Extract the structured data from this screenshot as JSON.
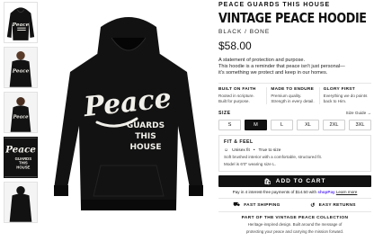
{
  "product": {
    "brand": "PEACE GUARDS THIS HOUSE",
    "title": "VINTAGE PEACE HOODIE",
    "variant": "BLACK / BONE",
    "price": "$58.00",
    "description": [
      "A statement of protection and purpose.",
      "This hoodie is a reminder that peace isn't just personal—",
      "it's something we protect and keep in our homes."
    ]
  },
  "graphic": {
    "script": "Peace",
    "line1": "GUARDS",
    "line2": "THIS",
    "line3": "HOUSE"
  },
  "features": [
    {
      "heading": "BUILT ON FAITH",
      "text": "Rooted in scripture. Built for purpose."
    },
    {
      "heading": "MADE TO ENDURE",
      "text": "Premium quality. Strength in every detail."
    },
    {
      "heading": "GLORY FIRST",
      "text": "Everything we do points back to Him."
    }
  ],
  "size": {
    "label": "SIZE",
    "guide": "Size Guide →",
    "options": [
      "S",
      "M",
      "L",
      "XL",
      "2XL",
      "3XL"
    ],
    "selected": "M"
  },
  "fit": {
    "heading": "FIT & FEEL",
    "fit_label": "Unisex fit",
    "size_note": "True to size",
    "text1": "Soft brushed interior with a comfortable, structured fit.",
    "text2": "Model is 6'0\" wearing size L."
  },
  "cart": {
    "label": "ADD TO CART"
  },
  "payment": {
    "text": "Pay in 4 interest-free payments of $14.50 with",
    "provider": "shop",
    "provider_suffix": "Pay",
    "link": "Learn more"
  },
  "shipping": [
    {
      "icon": "truck-icon",
      "label": "FAST SHIPPING"
    },
    {
      "icon": "return-icon",
      "label": "EASY RETURNS"
    }
  ],
  "collection": {
    "heading": "PART OF THE VINTAGE PEACE COLLECTION",
    "text1": "Heritage-inspired design. Built around the message of",
    "text2": "protecting your peace and carrying the mission forward."
  },
  "colors": {
    "hoodie": "#121212",
    "graphic": "#f2f0ea",
    "accent": "#111111",
    "shop_pay": "#5a31f4"
  }
}
